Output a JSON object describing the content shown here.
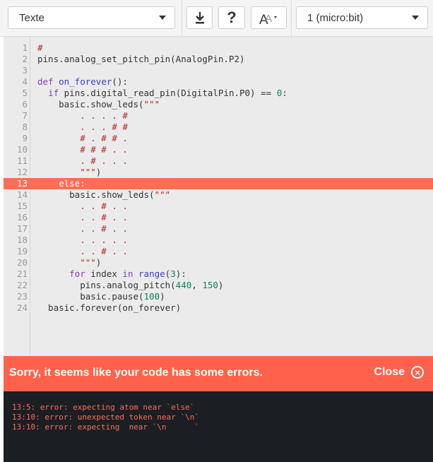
{
  "toolbar": {
    "language_select": "Texte",
    "download_icon": "download-icon",
    "help_label": "?",
    "text_size_icon": "text-size-icon",
    "device_select": "1 (micro:bit)"
  },
  "editor": {
    "lines": [
      {
        "n": "1",
        "tokens": [
          {
            "t": "#",
            "c": "str"
          }
        ]
      },
      {
        "n": "2",
        "tokens": [
          {
            "t": "pins.analog_set_pitch_pin(AnalogPin.P2)",
            "c": ""
          }
        ]
      },
      {
        "n": "3",
        "tokens": []
      },
      {
        "n": "4",
        "tokens": [
          {
            "t": "def ",
            "c": "kw"
          },
          {
            "t": "on_forever",
            "c": "fn"
          },
          {
            "t": "():",
            "c": ""
          }
        ]
      },
      {
        "n": "5",
        "tokens": [
          {
            "t": "  ",
            "c": ""
          },
          {
            "t": "if",
            "c": "kw"
          },
          {
            "t": " pins.digital_read_pin(DigitalPin.P0) == ",
            "c": ""
          },
          {
            "t": "0",
            "c": "num"
          },
          {
            "t": ":",
            "c": ""
          }
        ]
      },
      {
        "n": "6",
        "tokens": [
          {
            "t": "    basic.show_leds(",
            "c": ""
          },
          {
            "t": "\"\"\"",
            "c": "str"
          }
        ]
      },
      {
        "n": "7",
        "tokens": [
          {
            "t": "        . . . . #",
            "c": "str"
          }
        ]
      },
      {
        "n": "8",
        "tokens": [
          {
            "t": "        . . . # #",
            "c": "str"
          }
        ]
      },
      {
        "n": "9",
        "tokens": [
          {
            "t": "        # . # # .",
            "c": "str"
          }
        ]
      },
      {
        "n": "10",
        "tokens": [
          {
            "t": "        # # # . .",
            "c": "str"
          }
        ]
      },
      {
        "n": "11",
        "tokens": [
          {
            "t": "        . # . . .",
            "c": "str"
          }
        ]
      },
      {
        "n": "12",
        "tokens": [
          {
            "t": "        \"\"\"",
            "c": "str"
          },
          {
            "t": ")",
            "c": ""
          }
        ]
      },
      {
        "n": "13",
        "error": true,
        "tokens": [
          {
            "t": "    else",
            "c": "kwe"
          },
          {
            "t": ":",
            "c": "kwe"
          }
        ]
      },
      {
        "n": "14",
        "tokens": [
          {
            "t": "      basic.show_leds(",
            "c": ""
          },
          {
            "t": "\"\"\"",
            "c": "str"
          }
        ]
      },
      {
        "n": "15",
        "tokens": [
          {
            "t": "        . . # . .",
            "c": "str"
          }
        ]
      },
      {
        "n": "16",
        "tokens": [
          {
            "t": "        . . # . .",
            "c": "str"
          }
        ]
      },
      {
        "n": "17",
        "tokens": [
          {
            "t": "        . . # . .",
            "c": "str"
          }
        ]
      },
      {
        "n": "18",
        "tokens": [
          {
            "t": "        . . . . .",
            "c": "str"
          }
        ]
      },
      {
        "n": "19",
        "tokens": [
          {
            "t": "        . . # . .",
            "c": "str"
          }
        ]
      },
      {
        "n": "20",
        "tokens": [
          {
            "t": "        \"\"\"",
            "c": "str"
          },
          {
            "t": ")",
            "c": ""
          }
        ]
      },
      {
        "n": "21",
        "tokens": [
          {
            "t": "      ",
            "c": ""
          },
          {
            "t": "for",
            "c": "kw"
          },
          {
            "t": " index ",
            "c": ""
          },
          {
            "t": "in",
            "c": "kw"
          },
          {
            "t": " ",
            "c": ""
          },
          {
            "t": "range",
            "c": "fn"
          },
          {
            "t": "(",
            "c": ""
          },
          {
            "t": "3",
            "c": "num"
          },
          {
            "t": "):",
            "c": ""
          }
        ]
      },
      {
        "n": "22",
        "tokens": [
          {
            "t": "        pins.analog_pitch(",
            "c": ""
          },
          {
            "t": "440",
            "c": "num"
          },
          {
            "t": ", ",
            "c": ""
          },
          {
            "t": "150",
            "c": "num"
          },
          {
            "t": ")",
            "c": ""
          }
        ]
      },
      {
        "n": "23",
        "tokens": [
          {
            "t": "        basic.pause(",
            "c": ""
          },
          {
            "t": "100",
            "c": "num"
          },
          {
            "t": ")",
            "c": ""
          }
        ]
      },
      {
        "n": "24",
        "tokens": [
          {
            "t": "  basic.forever(on_forever)",
            "c": ""
          }
        ]
      }
    ]
  },
  "error_banner": {
    "message": "Sorry, it seems like your code has some errors.",
    "close_label": "Close",
    "close_glyph": "×"
  },
  "console": {
    "lines": [
      "13:5: error: expecting atom near `else`",
      "13:10: error: unexpected token near `\\n`",
      "13:10: error: expecting  near `\\n      `"
    ]
  },
  "colors": {
    "error_highlight": "#ff6d55",
    "banner": "#ff614a",
    "console_bg": "#1b1f24"
  }
}
